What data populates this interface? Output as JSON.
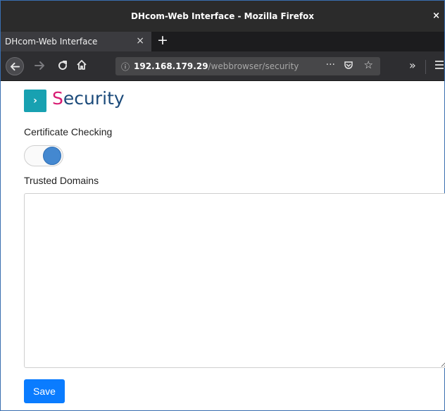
{
  "window": {
    "title": "DHcom-Web Interface - Mozilla Firefox",
    "close_glyph": "×"
  },
  "tabs": [
    {
      "label": "DHcom-Web Interface",
      "close_glyph": "×"
    }
  ],
  "newtab_glyph": "+",
  "toolbar": {
    "url_host": "192.168.179.29",
    "url_path": "/webbrowser/security",
    "page_actions_glyph": "···",
    "bookmark_glyph": "☆",
    "overflow_glyph": "»",
    "icons": [
      "back-icon",
      "forward-icon",
      "reload-icon",
      "home-icon",
      "info-icon",
      "pocket-icon",
      "bookmark-star-icon",
      "overflow-icon",
      "hamburger-menu-icon"
    ]
  },
  "page": {
    "section_icon_glyph": "›",
    "title_first": "S",
    "title_rest": "ecurity",
    "certificate_label": "Certificate Checking",
    "certificate_enabled": true,
    "trusted_label": "Trusted Domains",
    "trusted_value": "",
    "save_label": "Save"
  },
  "colors": {
    "accent_teal": "#18a1b1",
    "title_pink": "#d81b72",
    "title_navy": "#1b4a7a",
    "toggle_on": "#4488d0",
    "save_button": "#0a7cff"
  }
}
